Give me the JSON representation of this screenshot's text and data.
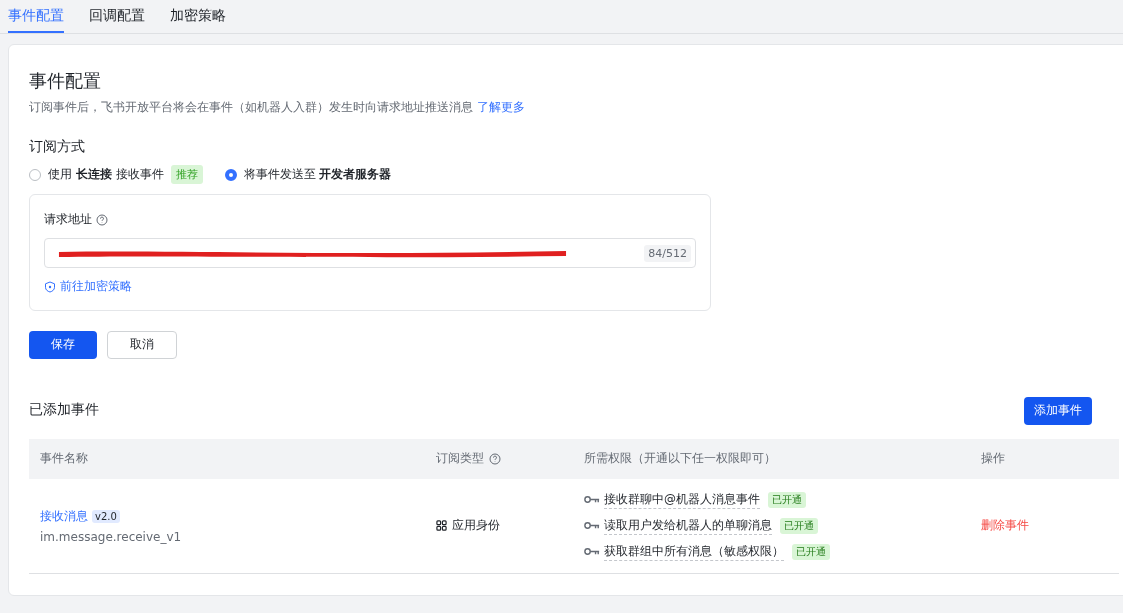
{
  "tabs": [
    {
      "label": "事件配置",
      "selected": true
    },
    {
      "label": "回调配置",
      "selected": false
    },
    {
      "label": "加密策略",
      "selected": false
    }
  ],
  "title": "事件配置",
  "description": {
    "text": "订阅事件后，飞书开放平台将会在事件（如机器人入群）发生时向请求地址推送消息",
    "link": "了解更多"
  },
  "subscription": {
    "label": "订阅方式",
    "options": [
      {
        "text": "使用 **长连接** 接收事件",
        "tag": "推荐",
        "selected": false
      },
      {
        "text": "将事件发送至 **开发者服务器**",
        "selected": true
      }
    ]
  },
  "request_url": {
    "label": "请求地址",
    "redacted": true,
    "counter": "84/512",
    "link": "前往加密策略"
  },
  "buttons": {
    "save": "保存",
    "cancel": "取消"
  },
  "events": {
    "title": "已添加事件",
    "add_button": "添加事件",
    "columns": [
      "事件名称",
      "订阅类型",
      "所需权限（开通以下任一权限即可）",
      "操作"
    ],
    "rows": [
      {
        "name": "接收消息",
        "version": "v2.0",
        "code": "im.message.receive_v1",
        "type": "应用身份",
        "permissions": [
          {
            "name": "接收群聊中@机器人消息事件",
            "status": "已开通"
          },
          {
            "name": "读取用户发给机器人的单聊消息",
            "status": "已开通"
          },
          {
            "name": "获取群组中所有消息（敏感权限）",
            "status": "已开通"
          }
        ],
        "action": "删除事件"
      }
    ]
  }
}
